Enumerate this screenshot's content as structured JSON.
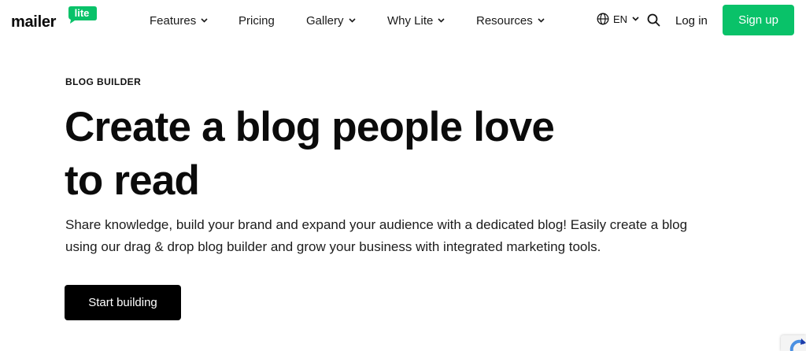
{
  "brand": {
    "word": "mailer",
    "badge": "lite",
    "color": "#09c269"
  },
  "nav": {
    "items": [
      {
        "label": "Features",
        "has_dropdown": true
      },
      {
        "label": "Pricing",
        "has_dropdown": false
      },
      {
        "label": "Gallery",
        "has_dropdown": true
      },
      {
        "label": "Why Lite",
        "has_dropdown": true
      },
      {
        "label": "Resources",
        "has_dropdown": true
      }
    ],
    "language": "EN",
    "login": "Log in",
    "signup": "Sign up"
  },
  "hero": {
    "eyebrow": "BLOG BUILDER",
    "title_line1": "Create a blog people love",
    "title_line2": "to read",
    "description_line1": "Share knowledge, build your brand and expand your audience with a dedicated blog! Easily create a blog",
    "description_line2": "using our drag & drop blog builder and grow your business with integrated marketing tools.",
    "cta": "Start building"
  },
  "icons": {
    "globe": "globe-icon",
    "search": "search-icon",
    "chevron": "chevron-down-icon",
    "corner_widget": "recaptcha-icon"
  }
}
